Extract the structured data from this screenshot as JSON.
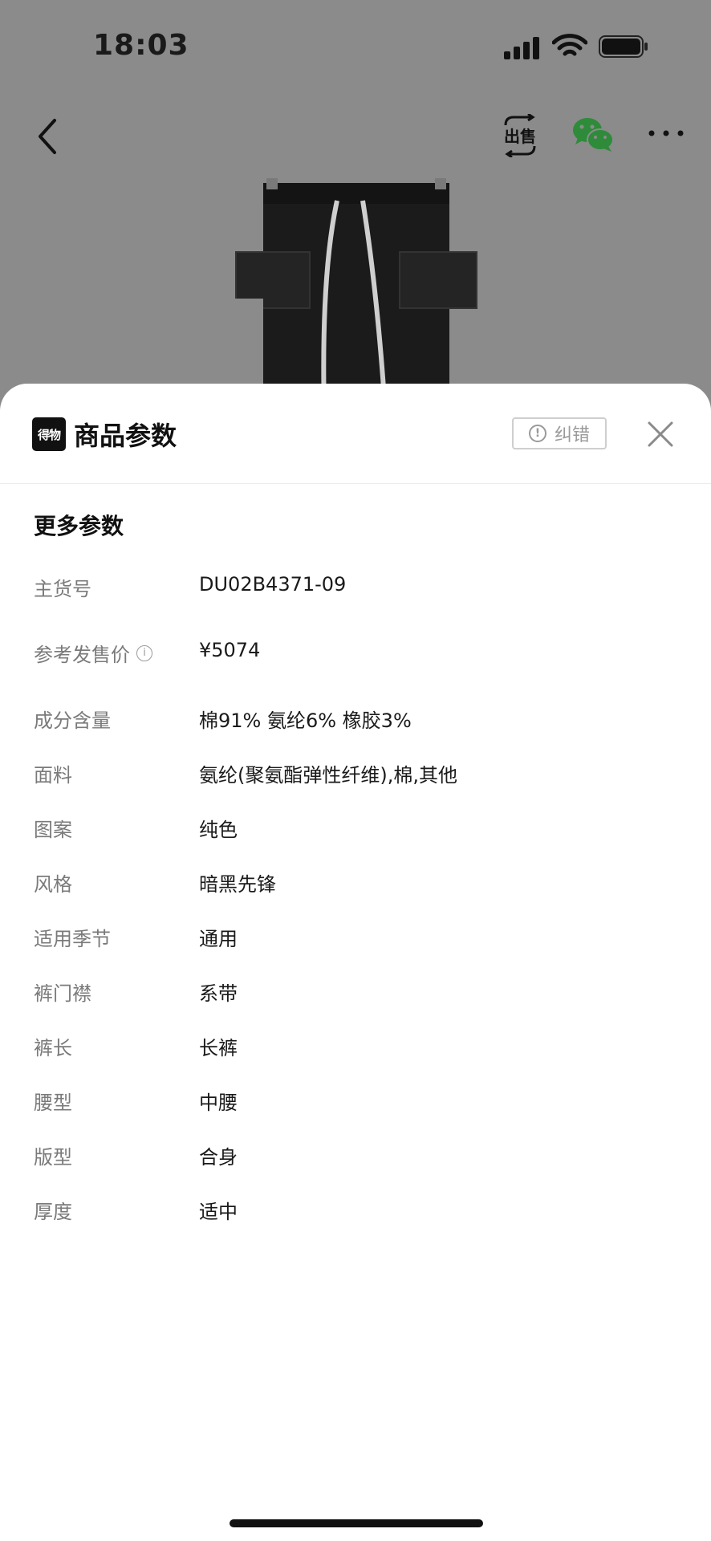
{
  "status": {
    "time": "18:03"
  },
  "nav": {
    "sell_label": "出售"
  },
  "sheet": {
    "logo_text": "得物",
    "title": "商品参数",
    "report_label": "纠错",
    "section_title": "更多参数"
  },
  "params": [
    {
      "label": "主货号",
      "value": "DU02B4371-09"
    },
    {
      "label": "参考发售价",
      "value": "¥5074"
    },
    {
      "label": "成分含量",
      "value": "棉91% 氨纶6% 橡胶3%"
    },
    {
      "label": "面料",
      "value": "氨纶(聚氨酯弹性纤维),棉,其他"
    },
    {
      "label": "图案",
      "value": "纯色"
    },
    {
      "label": "风格",
      "value": "暗黑先锋"
    },
    {
      "label": "适用季节",
      "value": "通用"
    },
    {
      "label": "裤门襟",
      "value": "系带"
    },
    {
      "label": "裤长",
      "value": "长裤"
    },
    {
      "label": "腰型",
      "value": "中腰"
    },
    {
      "label": "版型",
      "value": "合身"
    },
    {
      "label": "厚度",
      "value": "适中"
    }
  ],
  "colors": {
    "overlay": "#8b8b8b",
    "wechat_green": "#2e8b3a",
    "label_gray": "#7a7a7a"
  }
}
